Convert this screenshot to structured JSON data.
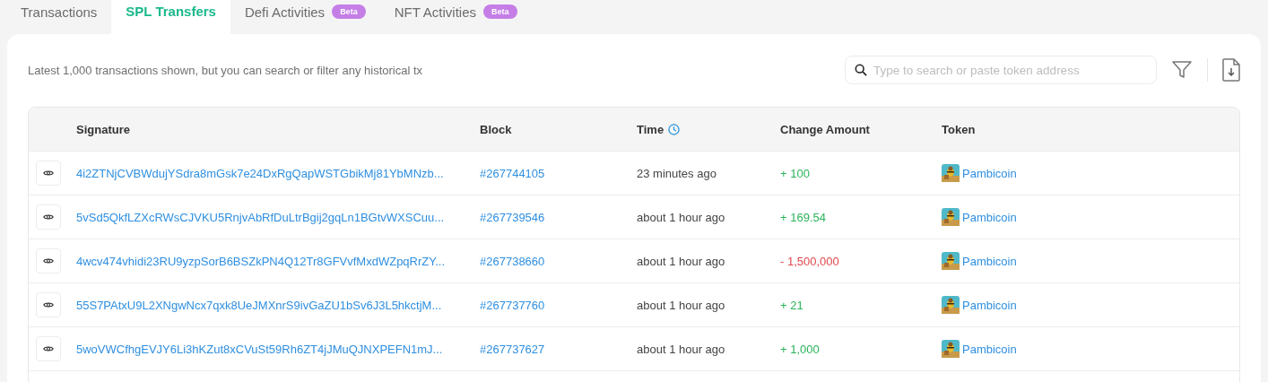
{
  "tabs": [
    {
      "label": "Transactions",
      "selected": false
    },
    {
      "label": "SPL Transfers",
      "selected": true
    },
    {
      "label": "Defi Activities",
      "selected": false,
      "badge": "Beta"
    },
    {
      "label": "NFT Activities",
      "selected": false,
      "badge": "Beta"
    }
  ],
  "notice": "Latest 1,000 transactions shown, but you can search or filter any historical tx",
  "search": {
    "placeholder": "Type to search or paste token address"
  },
  "table": {
    "columns": [
      "Signature",
      "Block",
      "Time",
      "Change Amount",
      "Token"
    ],
    "rows": [
      {
        "signature": "4i2ZTNjCVBWdujYSdra8mGsk7e24DxRgQapWSTGbikMj81YbMNzb...",
        "block": "#267744105",
        "time": "23 minutes ago",
        "amount": "+ 100",
        "kind": "credit",
        "token": "Pambicoin"
      },
      {
        "signature": "5vSd5QkfLZXcRWsCJVKU5RnjvAbRfDuLtrBgij2gqLn1BGtvWXSCuu...",
        "block": "#267739546",
        "time": "about 1 hour ago",
        "amount": "+ 169.54",
        "kind": "credit",
        "token": "Pambicoin"
      },
      {
        "signature": "4wcv474vhidi23RU9yzpSorB6BSZkPN4Q12Tr8GFVvfMxdWZpqRrZY...",
        "block": "#267738660",
        "time": "about 1 hour ago",
        "amount": "- 1,500,000",
        "kind": "debit",
        "token": "Pambicoin"
      },
      {
        "signature": "55S7PAtxU9L2XNgwNcx7qxk8UeJMXnrS9ivGaZU1bSv6J3L5hkctjM...",
        "block": "#267737760",
        "time": "about 1 hour ago",
        "amount": "+ 21",
        "kind": "credit",
        "token": "Pambicoin"
      },
      {
        "signature": "5woVWCfhgEVJY6Li3hKZut8xCVuSt59Rh6ZT4jJMuQJNXPEFN1mJ...",
        "block": "#267737627",
        "time": "about 1 hour ago",
        "amount": "+ 1,000",
        "kind": "credit",
        "token": "Pambicoin"
      }
    ]
  }
}
